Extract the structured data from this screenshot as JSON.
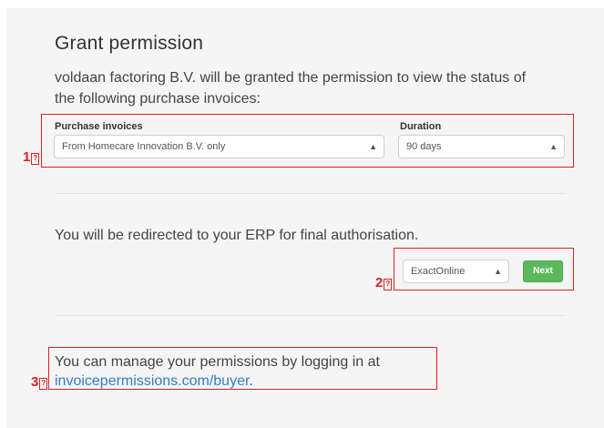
{
  "dialog": {
    "title": "Grant permission",
    "description": "voldaan factoring B.V. will be granted the permission to view the status of the following purchase invoices:"
  },
  "form": {
    "purchase_label": "Purchase invoices",
    "purchase_value": "From Homecare Innovation B.V. only",
    "duration_label": "Duration",
    "duration_value": "90 days"
  },
  "redirect": {
    "text": "You will be redirected to your ERP for final authorisation.",
    "erp_value": "ExactOnline",
    "next_label": "Next"
  },
  "manage": {
    "text": "You can manage your permissions by logging in at",
    "link": "invoicepermissions.com/buyer",
    "period": "."
  },
  "annotations": {
    "m1": "1",
    "m2": "2",
    "m3": "3",
    "box_glyph": "?",
    "color": "#e02020"
  },
  "colors": {
    "panel_bg": "#f5f5f5",
    "button_green": "#5cb85c",
    "link_blue": "#2f7dc4"
  },
  "icons": {
    "select_arrows": "up-down-caret-icon"
  }
}
